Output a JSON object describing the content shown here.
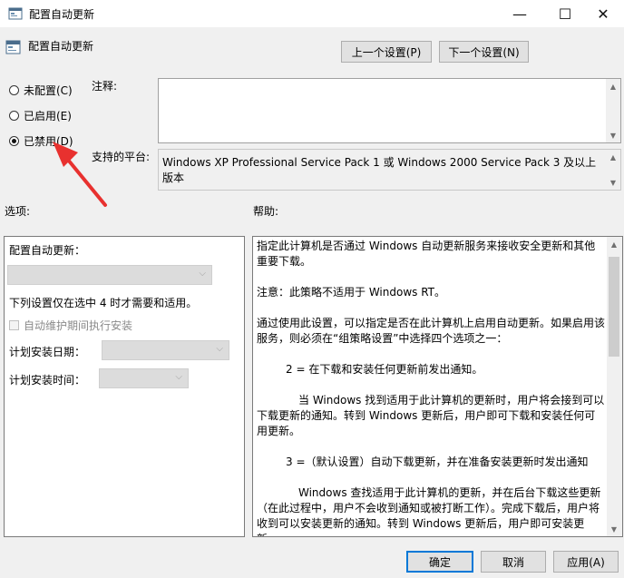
{
  "window": {
    "title": "配置自动更新",
    "minimize": "—",
    "maximize": "☐",
    "close": "✕"
  },
  "header": {
    "title": "配置自动更新",
    "prev_button": "上一个设置(P)",
    "next_button": "下一个设置(N)"
  },
  "state": {
    "options": [
      {
        "label": "未配置(C)",
        "checked": false
      },
      {
        "label": "已启用(E)",
        "checked": false
      },
      {
        "label": "已禁用(D)",
        "checked": true
      }
    ]
  },
  "comment": {
    "label": "注释:",
    "value": ""
  },
  "platform": {
    "label": "支持的平台:",
    "value": "Windows XP Professional Service Pack 1 或 Windows 2000 Service Pack 3 及以上版本"
  },
  "sections": {
    "options_label": "选项:",
    "help_label": "帮助:"
  },
  "options_panel": {
    "configure_label": "配置自动更新：",
    "note": "下列设置仅在选中 4 时才需要和适用。",
    "maintenance_checkbox": "自动维护期间执行安装",
    "schedule_day_label": "计划安装日期：",
    "schedule_time_label": "计划安装时间："
  },
  "help": {
    "paragraphs": [
      "指定此计算机是否通过 Windows 自动更新服务来接收安全更新和其他重要下载。",
      "注意：此策略不适用于 Windows RT。",
      "通过使用此设置，可以指定是否在此计算机上启用自动更新。如果启用该服务，则必须在“组策略设置”中选择四个选项之一：",
      "2 = 在下载和安装任何更新前发出通知。",
      "当 Windows 找到适用于此计算机的更新时，用户将会接到可以下载更新的通知。转到 Windows 更新后，用户即可下载和安装任何可用更新。",
      "3 =（默认设置）自动下载更新，并在准备安装更新时发出通知",
      "Windows 查找适用于此计算机的更新，并在后台下载这些更新（在此过程中，用户不会收到通知或被打断工作）。完成下载后，用户将收到可以安装更新的通知。转到 Windows 更新后，用户即可安装更新。"
    ]
  },
  "footer": {
    "ok": "确定",
    "cancel": "取消",
    "apply": "应用(A)"
  },
  "colors": {
    "accent": "#0078d7",
    "annotation_arrow": "#e8312f"
  }
}
